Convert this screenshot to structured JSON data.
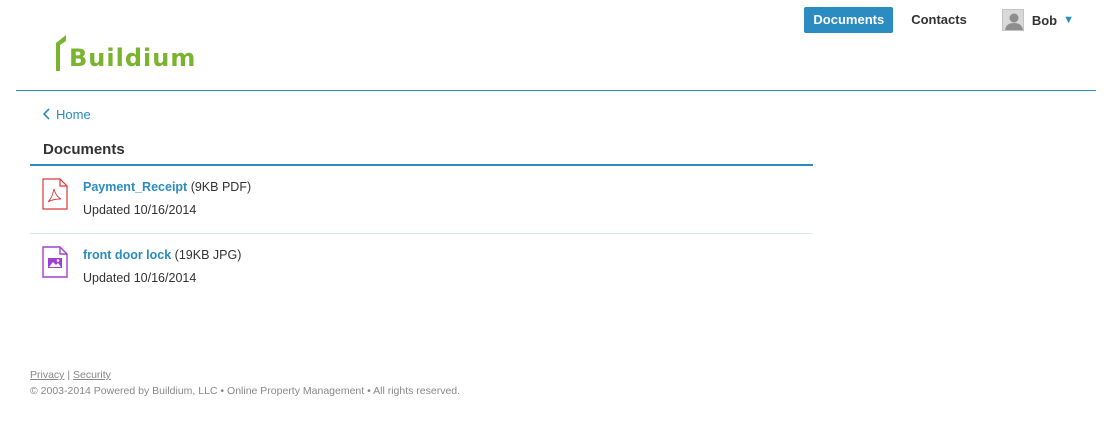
{
  "brand": {
    "name": "Buildium",
    "color": "#7ab32e"
  },
  "colors": {
    "accent": "#2a8cc0",
    "pdf_icon": "#d93a3a",
    "jpg_icon": "#a040d0"
  },
  "topnav": {
    "documents_label": "Documents",
    "contacts_label": "Contacts",
    "user_name": "Bob",
    "user_caret": "▼"
  },
  "breadcrumb": {
    "back_label": "Home"
  },
  "section": {
    "title": "Documents"
  },
  "documents": [
    {
      "name": "Payment_Receipt",
      "meta": " (9KB PDF)",
      "updated": "Updated 10/16/2014",
      "icon": "pdf-file-icon"
    },
    {
      "name": "front door lock",
      "meta": " (19KB JPG)",
      "updated": "Updated 10/16/2014",
      "icon": "image-file-icon"
    }
  ],
  "footer": {
    "privacy_label": "Privacy",
    "separator": " | ",
    "security_label": "Security",
    "copyright": "© 2003-2014 Powered by Buildium, LLC • Online Property Management • All rights reserved."
  }
}
